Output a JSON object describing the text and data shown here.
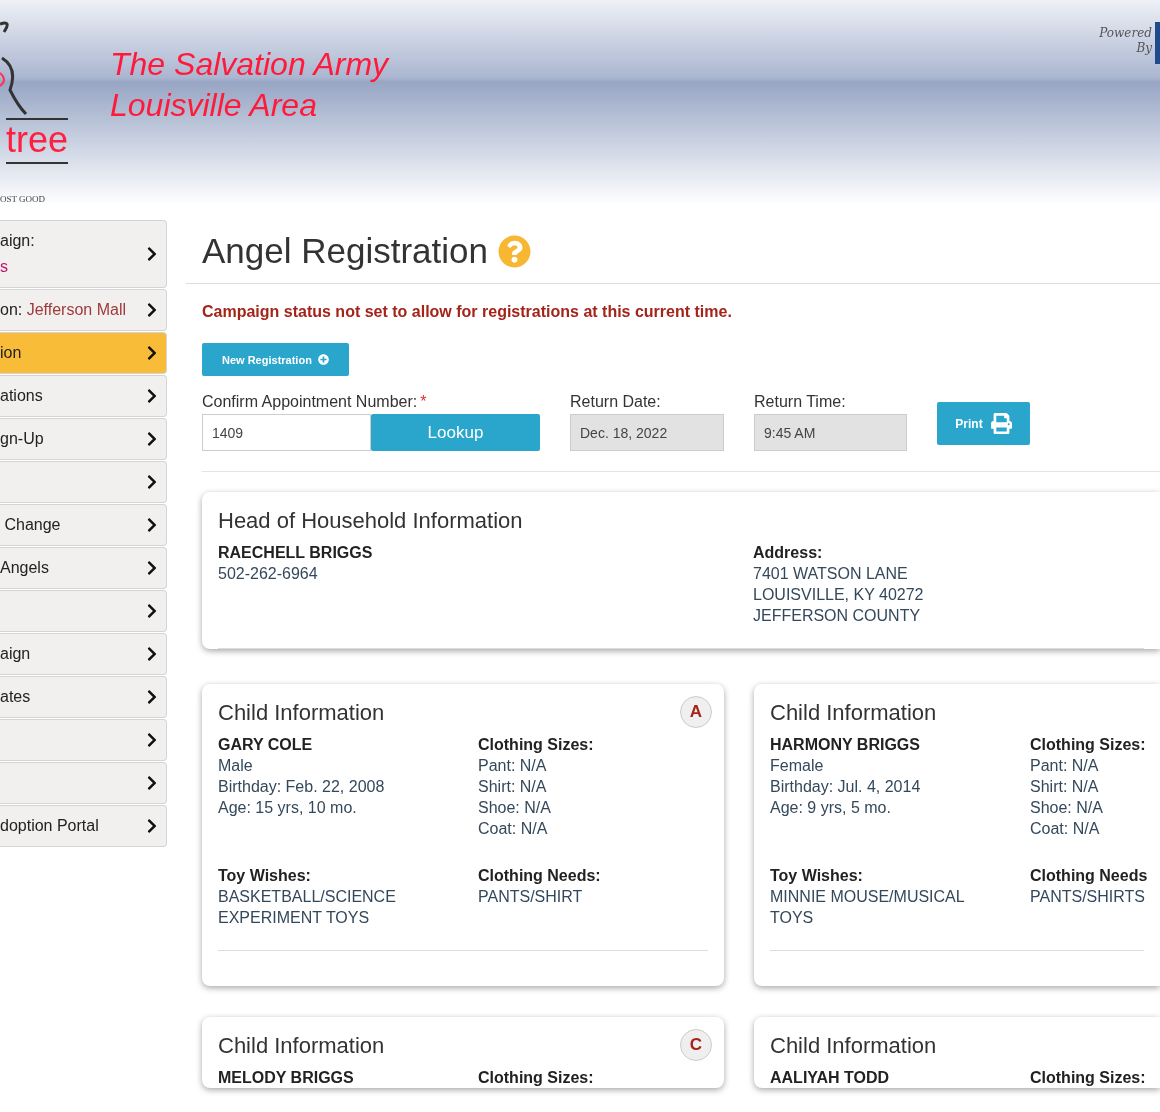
{
  "header": {
    "title_lines": [
      "The Salvation Army",
      "Louisville Area"
    ],
    "logo_text": "tree",
    "tagline": "OST GOOD",
    "powered_by": [
      "Powered",
      "By"
    ]
  },
  "sidebar": {
    "items": [
      {
        "kind": "two_line",
        "label": "aign:",
        "value": "s",
        "selected": false
      },
      {
        "kind": "inline",
        "label": "on: ",
        "value": "Jefferson Mall",
        "selected": false
      },
      {
        "label": "ion",
        "selected": true
      },
      {
        "label": "ations",
        "selected": false
      },
      {
        "label": "gn-Up",
        "selected": false
      },
      {
        "selected": false
      },
      {
        "label": " Change",
        "selected": false
      },
      {
        "label": "Angels",
        "selected": false
      },
      {
        "selected": false
      },
      {
        "label": "aign",
        "selected": false
      },
      {
        "label": "ates",
        "selected": false
      },
      {
        "selected": false
      },
      {
        "selected": false
      },
      {
        "label": "doption Portal",
        "selected": false
      }
    ]
  },
  "page": {
    "title": "Angel Registration",
    "alert": "Campaign status not set to allow for registrations at this current time.",
    "new_button": "New Registration",
    "form": {
      "appointment_label": "Confirm Appointment Number:",
      "required_mark": "*",
      "appointment_value": "1409",
      "lookup_button": "Lookup",
      "return_date_label": "Return Date:",
      "return_date": "Dec. 18, 2022",
      "return_time_label": "Return Time:",
      "return_time": "9:45 AM",
      "print_button": "Print"
    }
  },
  "household": {
    "title": "Head of Household Information",
    "name": "RAECHELL BRIGGS",
    "phone": "502-262-6964",
    "address_label": "Address:",
    "address_lines": [
      "7401 WATSON LANE",
      "LOUISVILLE, KY 40272",
      "JEFFERSON COUNTY"
    ]
  },
  "children": [
    {
      "title": "Child Information",
      "badge": "A",
      "name": "GARY COLE",
      "details": [
        "Male",
        "Birthday: Feb. 22, 2008",
        "Age: 15 yrs, 10 mo."
      ],
      "sizes_label": "Clothing Sizes:",
      "sizes": [
        "Pant: N/A",
        "Shirt: N/A",
        "Shoe: N/A",
        "Coat: N/A"
      ],
      "toy_label": "Toy Wishes:",
      "toys": "BASKETBALL/SCIENCE EXPERIMENT TOYS",
      "needs_label": "Clothing Needs:",
      "needs": "PANTS/SHIRT"
    },
    {
      "title": "Child Information",
      "name": "HARMONY BRIGGS",
      "details": [
        "Female",
        "Birthday: Jul. 4, 2014",
        "Age: 9 yrs, 5 mo."
      ],
      "sizes_label": "Clothing Sizes:",
      "sizes": [
        "Pant: N/A",
        "Shirt: N/A",
        "Shoe: N/A",
        "Coat: N/A"
      ],
      "toy_label": "Toy Wishes:",
      "toys": "MINNIE MOUSE/MUSICAL TOYS",
      "needs_label": "Clothing Needs",
      "needs": "PANTS/SHIRTS"
    },
    {
      "title": "Child Information",
      "badge": "C",
      "name": "MELODY BRIGGS",
      "sizes_label": "Clothing Sizes:"
    },
    {
      "title": "Child Information",
      "name": "AALIYAH TODD",
      "sizes_label": "Clothing Sizes:"
    }
  ]
}
